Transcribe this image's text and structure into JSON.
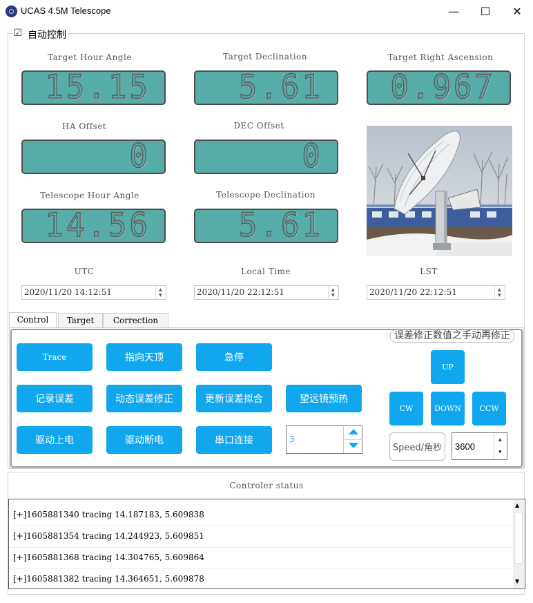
{
  "window": {
    "title": "UCAS 4.5M Telescope",
    "minimize_glyph": "—",
    "maximize_glyph": "☐",
    "close_glyph": "✕"
  },
  "auto_control": {
    "label": "自动控制",
    "checked": true,
    "check_glyph": "☑"
  },
  "readouts": {
    "target_hour_angle": {
      "label": "Target Hour Angle",
      "value": "15.15"
    },
    "target_declination": {
      "label": "Target Declination",
      "value": "5.61"
    },
    "target_right_ascension": {
      "label": "Target Right Ascension",
      "value": "0.967"
    },
    "ha_offset": {
      "label": "HA Offset",
      "value": "0"
    },
    "dec_offset": {
      "label": "DEC Offset",
      "value": "0"
    },
    "telescope_hour_angle": {
      "label": "Telescope Hour Angle",
      "value": "14.56"
    },
    "telescope_declination": {
      "label": "Telescope Declination",
      "value": "5.61"
    }
  },
  "times": {
    "utc": {
      "label": "UTC",
      "value": "2020/11/20 14:12:51"
    },
    "local": {
      "label": "Local Time",
      "value": "2020/11/20 22:12:51"
    },
    "lst": {
      "label": "LST",
      "value": "2020/11/20 22:12:51"
    }
  },
  "tabs": {
    "control": "Control",
    "target": "Target",
    "correction": "Correction"
  },
  "buttons": {
    "trace": "Trace",
    "point_zenith": "指向天顶",
    "emergency_stop": "急停",
    "record_error": "记录误差",
    "dynamic_error_correction": "动态误差修正",
    "update_error_fit": "更新误差拟合",
    "telescope_preheat": "望远镜预热",
    "drive_power_on": "驱动上电",
    "drive_power_off": "驱动断电",
    "serial_connect": "串口连接"
  },
  "numeric_input": {
    "value": "3"
  },
  "manual_correction": {
    "group_label": "误差修正数值之手动再修正",
    "up": "UP",
    "down": "DOWN",
    "cw": "CW",
    "ccw": "CCW",
    "speed_label": "Speed/角秒",
    "speed_value": "3600"
  },
  "status": {
    "title": "Controler status",
    "lines": [
      "[+]1605881340 tracing 14.187183, 5.609838",
      "[+]1605881354 tracing 14.244923, 5.609851",
      "[+]1605881368 tracing 14.304765, 5.609864",
      "[+]1605881382 tracing 14.364651, 5.609878"
    ]
  },
  "colors": {
    "lcd": "#56ada8",
    "button": "#10a7ee"
  }
}
